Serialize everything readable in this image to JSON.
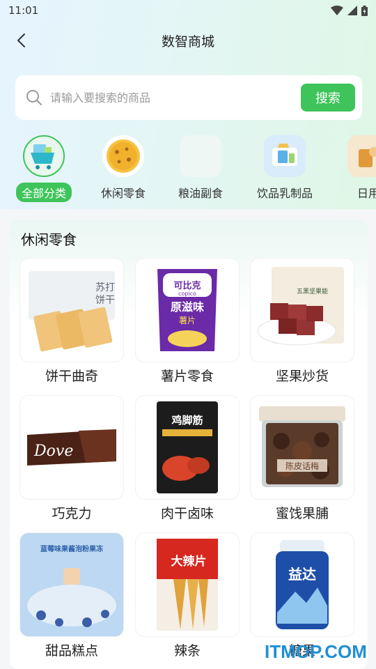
{
  "status_bar": {
    "time": "11:01"
  },
  "header": {
    "title": "数智商城"
  },
  "search": {
    "placeholder": "请输入要搜索的商品",
    "button_label": "搜索"
  },
  "categories": [
    {
      "label": "全部分类",
      "active": true
    },
    {
      "label": "休闲零食"
    },
    {
      "label": "粮油副食"
    },
    {
      "label": "饮品乳制品"
    },
    {
      "label": "日用"
    }
  ],
  "section": {
    "title": "休闲零食",
    "products": [
      {
        "name": "饼干曲奇",
        "package_text": [
          "苏打",
          "饼干"
        ]
      },
      {
        "name": "薯片零食",
        "package_text": [
          "可比克",
          "copico",
          "原滋味",
          "薯片"
        ]
      },
      {
        "name": "坚果炒货",
        "package_text": [
          "五黑坚果能"
        ]
      },
      {
        "name": "巧克力",
        "package_text": [
          "Dove"
        ]
      },
      {
        "name": "肉干卤味",
        "package_text": [
          "鸡脚筋"
        ]
      },
      {
        "name": "蜜饯果脯",
        "package_text": [
          "陈皮话梅"
        ]
      },
      {
        "name": "甜品糕点",
        "package_text": [
          "蓝莓味果酱泡粉果冻"
        ]
      },
      {
        "name": "辣条",
        "package_text": [
          "大辣片"
        ]
      },
      {
        "name": "糖果",
        "package_text": [
          "益达"
        ]
      }
    ]
  },
  "watermark": "ITMOP.COM",
  "colors": {
    "accent": "#3ec45a",
    "watermark": "#1f8fd6"
  }
}
